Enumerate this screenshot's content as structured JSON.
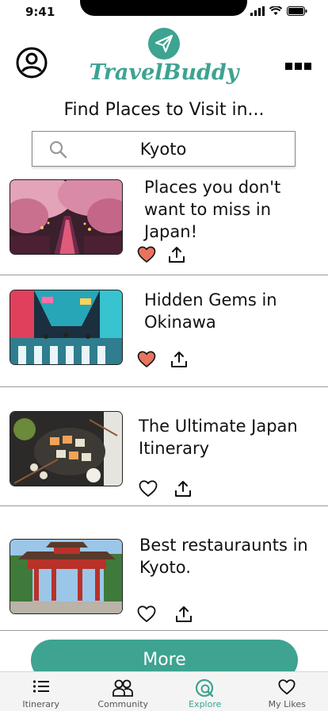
{
  "status_bar": {
    "time": "9:41"
  },
  "header": {
    "brand": "TravelBuddy",
    "find_title": "Find Places to Visit in..."
  },
  "search": {
    "value": "Kyoto"
  },
  "colors": {
    "accent": "#3ea391",
    "liked": "#e8745f"
  },
  "cards": [
    {
      "title": "Places you don't want to miss in Japan!",
      "liked": true,
      "thumb": "cherry-blossom-canal"
    },
    {
      "title": "Hidden Gems in Okinawa",
      "liked": true,
      "thumb": "neon-street-crossing"
    },
    {
      "title": "The Ultimate Japan Itinerary",
      "liked": false,
      "thumb": "sushi-platter"
    },
    {
      "title": "Best restauraunts in Kyoto.",
      "liked": false,
      "thumb": "red-gate-temple"
    }
  ],
  "more_button": {
    "label": "More"
  },
  "tabs": [
    {
      "label": "Itinerary",
      "icon": "list-icon",
      "active": false
    },
    {
      "label": "Community",
      "icon": "people-icon",
      "active": false
    },
    {
      "label": "Explore",
      "icon": "explore-search-icon",
      "active": true
    },
    {
      "label": "My Likes",
      "icon": "heart-icon",
      "active": false
    }
  ]
}
